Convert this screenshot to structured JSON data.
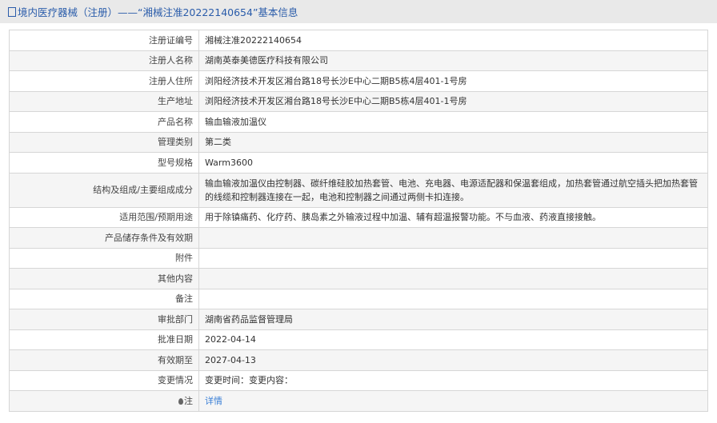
{
  "header": {
    "title": "境内医疗器械（注册）——“湘械注准20222140654”基本信息"
  },
  "rows": [
    {
      "label": "注册证编号",
      "value": "湘械注准20222140654"
    },
    {
      "label": "注册人名称",
      "value": "湖南英泰美德医疗科技有限公司"
    },
    {
      "label": "注册人住所",
      "value": "浏阳经济技术开发区湘台路18号长沙E中心二期B5栋4层401-1号房"
    },
    {
      "label": "生产地址",
      "value": "浏阳经济技术开发区湘台路18号长沙E中心二期B5栋4层401-1号房"
    },
    {
      "label": "产品名称",
      "value": "输血输液加温仪"
    },
    {
      "label": "管理类别",
      "value": "第二类"
    },
    {
      "label": "型号规格",
      "value": "Warm3600"
    },
    {
      "label": "结构及组成/主要组成成分",
      "value": "输血输液加温仪由控制器、碳纤维硅胶加热套管、电池、充电器、电源适配器和保温套组成，加热套管通过航空插头把加热套管的线缆和控制器连接在一起，电池和控制器之间通过两侧卡扣连接。"
    },
    {
      "label": "适用范围/预期用途",
      "value": "用于除镇痛药、化疗药、胰岛素之外输液过程中加温、辅有超温报警功能。不与血液、药液直接接触。"
    },
    {
      "label": "产品储存条件及有效期",
      "value": ""
    },
    {
      "label": "附件",
      "value": ""
    },
    {
      "label": "其他内容",
      "value": ""
    },
    {
      "label": "备注",
      "value": ""
    },
    {
      "label": "审批部门",
      "value": "湖南省药品监督管理局"
    },
    {
      "label": "批准日期",
      "value": "2022-04-14"
    },
    {
      "label": "有效期至",
      "value": "2027-04-13"
    },
    {
      "label": "变更情况",
      "value": "变更时间：变更内容："
    },
    {
      "label": "注",
      "value": "详情"
    }
  ]
}
